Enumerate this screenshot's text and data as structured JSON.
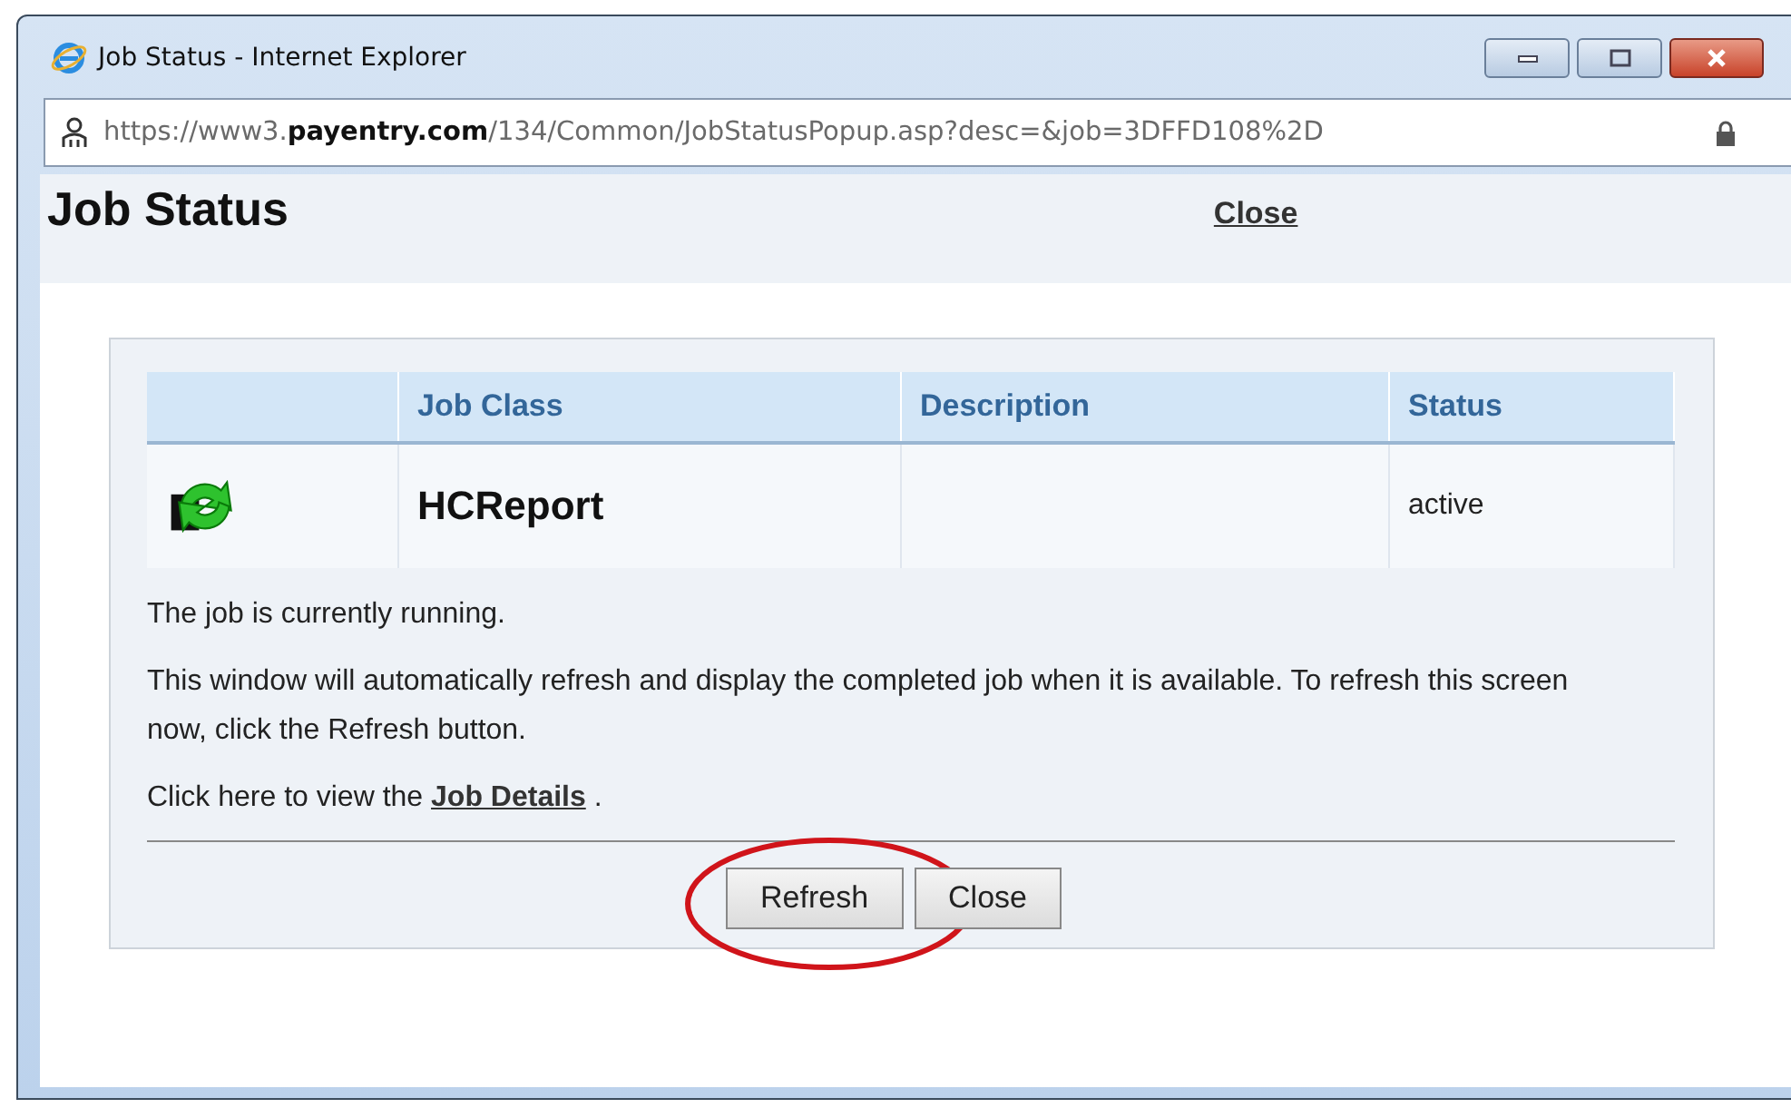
{
  "window": {
    "title": "Job Status - Internet Explorer",
    "url": "https://www3.**payentry.com**/134/Common/JobStatusPopup.asp?desc=&job=3DFFD108%2D"
  },
  "heading": "Job Status",
  "close_link": "Close",
  "table": {
    "columns": [
      "Job Class",
      "Description",
      "Status"
    ],
    "rows": [
      {
        "job_class": "HCReport",
        "description": "",
        "status": "active"
      }
    ]
  },
  "messages": [
    "The job is currently running.",
    "This window will automatically refresh and display the completed job when it is available. To refresh this screen now, click the Refresh button."
  ],
  "details_line": {
    "before": "Click here to view the",
    "link": "Job Details",
    "after": "."
  },
  "buttons": [
    {
      "label": "Refresh",
      "circled": true
    },
    {
      "label": "Close",
      "circled": false
    }
  ]
}
